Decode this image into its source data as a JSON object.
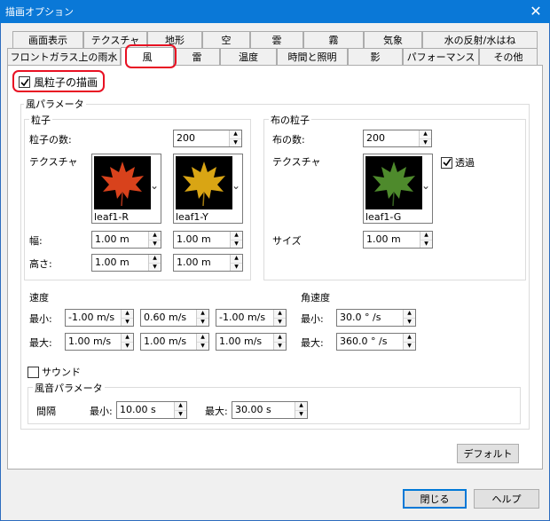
{
  "window": {
    "title": "描画オプション",
    "close_label": "✕"
  },
  "tabs_row1": [
    "画面表示",
    "テクスチャ",
    "地形",
    "空",
    "雲",
    "霧",
    "気象",
    "水の反射/水はね"
  ],
  "tabs_row2": [
    "フロントガラス上の雨水",
    "風",
    "雷",
    "温度",
    "時間と照明",
    "影",
    "パフォーマンス",
    "その他"
  ],
  "active_tab": "風",
  "wind_particles_checkbox": {
    "label": "風粒子の描画",
    "checked": true
  },
  "wind_params": {
    "title": "風パラメータ",
    "particles": {
      "title": "粒子",
      "count_label": "粒子の数:",
      "count_value": "200",
      "texture_label": "テクスチャ",
      "textures": [
        "leaf1-R",
        "leaf1-Y"
      ],
      "width_label": "幅:",
      "height_label": "高さ:",
      "width_values": [
        "1.00 m",
        "1.00 m"
      ],
      "height_values": [
        "1.00 m",
        "1.00 m"
      ]
    },
    "cloth": {
      "title": "布の粒子",
      "count_label": "布の数:",
      "count_value": "200",
      "texture_label": "テクスチャ",
      "texture": "leaf1-G",
      "transparent_label": "透過",
      "transparent_checked": true,
      "size_label": "サイズ",
      "size_value": "1.00 m"
    },
    "speed": {
      "title": "速度",
      "min_label": "最小:",
      "max_label": "最大:",
      "min_values": [
        "-1.00 m/s",
        "0.60 m/s",
        "-1.00 m/s"
      ],
      "max_values": [
        "1.00 m/s",
        "1.00 m/s",
        "1.00 m/s"
      ]
    },
    "angular_speed": {
      "title": "角速度",
      "min_label": "最小:",
      "max_label": "最大:",
      "min_value": "30.0 ° /s",
      "max_value": "360.0 ° /s"
    }
  },
  "sound": {
    "checkbox_label": "サウンド",
    "checked": false,
    "params_title": "風音パラメータ",
    "interval_label": "間隔",
    "min_label": "最小:",
    "min_value": "10.00 s",
    "max_label": "最大:",
    "max_value": "30.00 s"
  },
  "buttons": {
    "default": "デフォルト",
    "close": "閉じる",
    "help": "ヘルプ"
  },
  "colors": {
    "titlebar": "#0a78d7",
    "highlight": "#e81123",
    "leaf_red": "#d8421c",
    "leaf_yellow": "#d9a514",
    "leaf_green": "#4e8a2c"
  }
}
